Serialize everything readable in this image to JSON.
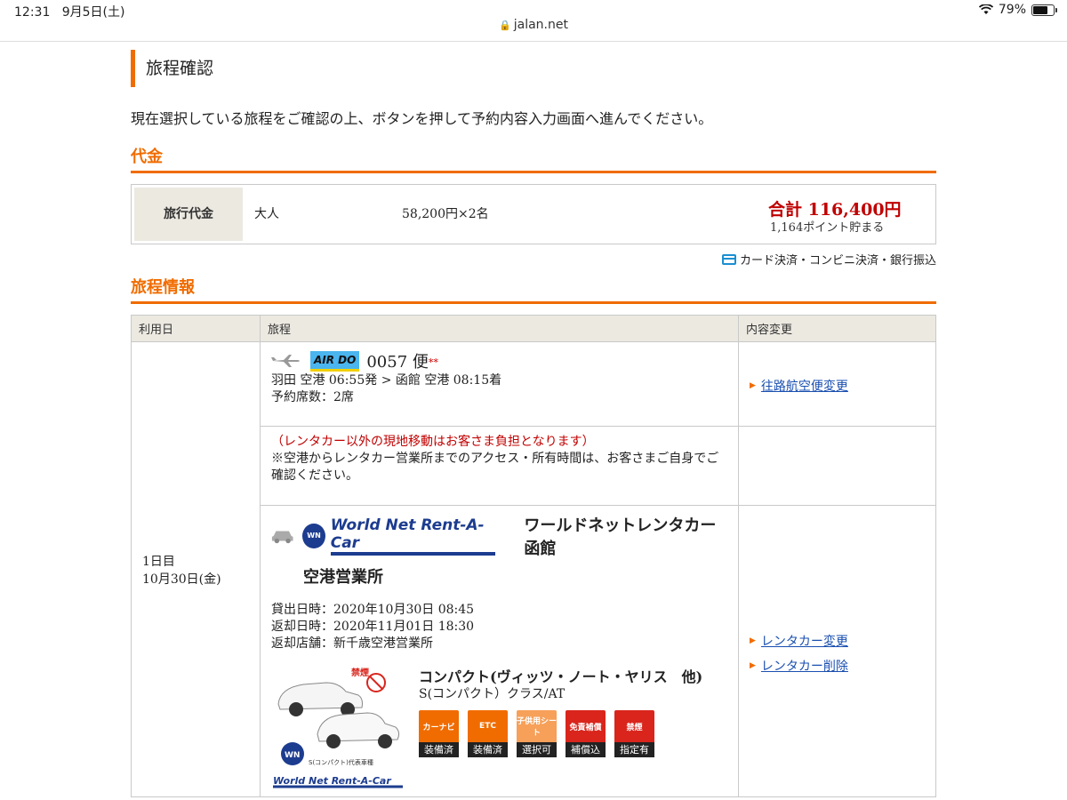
{
  "status": {
    "time": "12:31",
    "date": "9月5日(土)",
    "battery": "79%",
    "battery_level": 0.79
  },
  "browser": {
    "url": "jalan.net"
  },
  "page": {
    "title": "旅程確認",
    "intro": "現在選択している旅程をご確認の上、ボタンを押して予約内容入力画面へ進んでください。"
  },
  "price": {
    "section_title": "代金",
    "label": "旅行代金",
    "type": "大人",
    "unit_price": "58,200円×2名",
    "total": "合計 116,400円",
    "points": "1,164ポイント貯まる",
    "payment_methods": "カード決済・コンビニ決済・銀行振込"
  },
  "itinerary": {
    "section_title": "旅程情報",
    "headers": {
      "date": "利用日",
      "trip": "旅程",
      "change": "内容変更"
    },
    "date_day": "1日目",
    "date_value": "10月30日(金)",
    "flight": {
      "airline_logo": "AIR DO",
      "number": "0057 便",
      "marks": "**",
      "route": "羽田 空港 06:55発 > 函館 空港 08:15着",
      "seats": "予約席数：2席",
      "change_link": "往路航空便変更"
    },
    "notice": {
      "warning": "（レンタカー以外の現地移動はお客さま負担となります）",
      "text": "※空港からレンタカー営業所までのアクセス・所有時間は、お客さまご自身でご確認ください。"
    },
    "rental": {
      "logo_text": "World Net Rent-A-Car",
      "logo_badge": "WN",
      "shop_name_1": "ワールドネットレンタカー函館",
      "shop_name_2": "空港営業所",
      "pickup": "貸出日時：2020年10月30日 08:45",
      "return": "返却日時：2020年11月01日 18:30",
      "return_shop": "返却店舗：新千歳空港営業所",
      "car_class": "コンパクト(ヴィッツ・ノート・ヤリス　他)",
      "car_type": "S(コンパクト）クラス/AT",
      "photo_caption": "S(コンパクト)代表車種",
      "no_smoking": "禁煙",
      "equipment": [
        {
          "icon": "カーナビ",
          "status": "装備済"
        },
        {
          "icon": "ETC",
          "status": "装備済"
        },
        {
          "icon": "子供用シート",
          "status": "選択可"
        },
        {
          "icon": "免責補償",
          "status": "補償込"
        },
        {
          "icon": "禁煙",
          "status": "指定有"
        }
      ],
      "change_link": "レンタカー変更",
      "delete_link": "レンタカー削除"
    }
  }
}
